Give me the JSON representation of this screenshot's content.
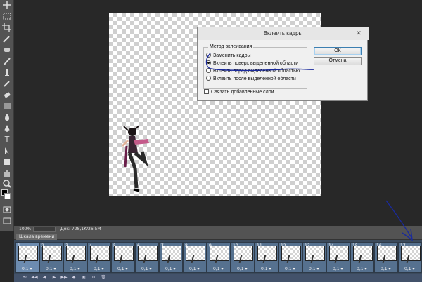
{
  "toolbar": {
    "tools": [
      "move-tool-icon",
      "marquee-icon",
      "lasso-icon",
      "quick-select-icon",
      "crop-icon",
      "eyedropper-icon",
      "healing-brush-icon",
      "brush-icon",
      "clone-stamp-icon",
      "history-brush-icon",
      "eraser-icon",
      "gradient-icon",
      "blur-icon",
      "dodge-icon",
      "pen-icon",
      "type-tool-icon",
      "path-select-icon",
      "shape-icon",
      "hand-icon",
      "zoom-icon"
    ],
    "type_glyph": "T"
  },
  "status": {
    "zoom": "100%",
    "doc_info": "Док: 728,1K/26,5M"
  },
  "timeline": {
    "tab_label": "Шкала времени",
    "frames": [
      {
        "num": "1",
        "delay": "0,1 ▾"
      },
      {
        "num": "2",
        "delay": "0,1 ▾"
      },
      {
        "num": "3",
        "delay": "0,1 ▾"
      },
      {
        "num": "4",
        "delay": "0,1 ▾"
      },
      {
        "num": "5",
        "delay": "0,1 ▾"
      },
      {
        "num": "6",
        "delay": "0,1 ▾"
      },
      {
        "num": "7",
        "delay": "0,1 ▾"
      },
      {
        "num": "8",
        "delay": "0,1 ▾"
      },
      {
        "num": "9",
        "delay": "0,1 ▾"
      },
      {
        "num": "10",
        "delay": "0,1 ▾"
      },
      {
        "num": "11",
        "delay": "0,1 ▾"
      },
      {
        "num": "12",
        "delay": "0,1 ▾"
      },
      {
        "num": "13",
        "delay": "0,1 ▾"
      },
      {
        "num": "14",
        "delay": "0,1 ▾"
      },
      {
        "num": "15",
        "delay": "0,1 ▾"
      },
      {
        "num": "16",
        "delay": "0,1 ▾"
      },
      {
        "num": "17",
        "delay": "0,1 ▾"
      }
    ],
    "controls": [
      "⟲",
      "◀◀",
      "◀",
      "▶",
      "▶▶",
      "◆",
      "▣",
      "⧉",
      "🗑"
    ]
  },
  "dialog": {
    "title": "Вклеить кадры",
    "close_glyph": "✕",
    "group_label": "Метод вклеивания",
    "options": [
      {
        "label": "Заменить кадры",
        "selected": false
      },
      {
        "label": "Вклеить поверх выделенной области",
        "selected": true
      },
      {
        "label": "Вклеить перед выделенной областью",
        "selected": false
      },
      {
        "label": "Вклеить после выделенной области",
        "selected": false
      }
    ],
    "checkbox_label": "Связать добавленные слои",
    "ok_label": "ОК",
    "cancel_label": "Отмена"
  },
  "colors": {
    "ink": "#1a2a9c",
    "panel": "#535353",
    "frame": "#56718f"
  }
}
